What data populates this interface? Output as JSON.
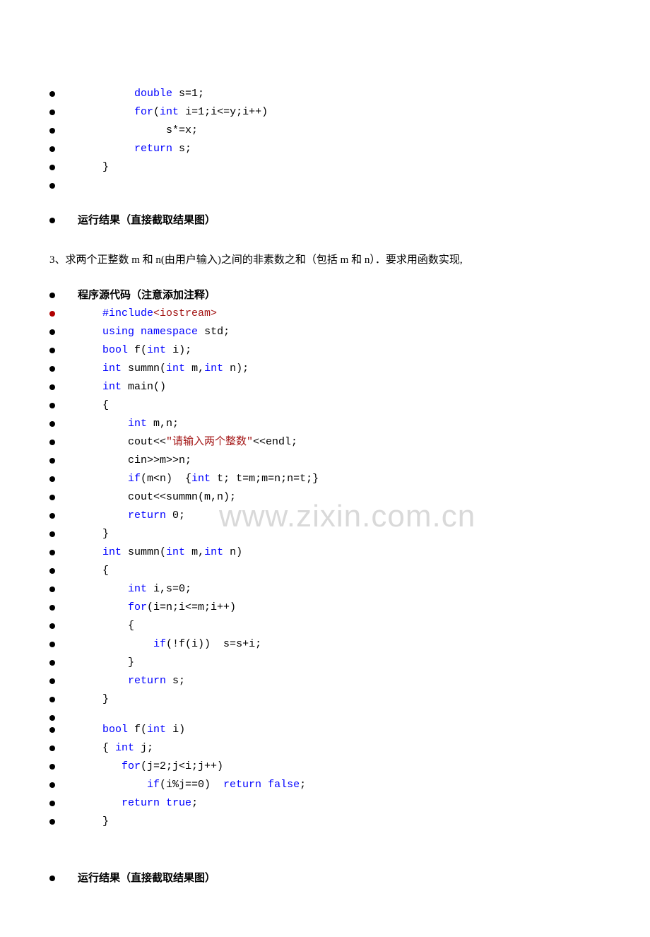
{
  "watermark": "www.zixin.com.cn",
  "block1": {
    "lines": [
      {
        "indent": "        ",
        "parts": [
          {
            "c": "kw",
            "t": "double"
          },
          {
            "c": "txt",
            "t": " s=1;"
          }
        ]
      },
      {
        "indent": "        ",
        "parts": [
          {
            "c": "kw",
            "t": "for"
          },
          {
            "c": "txt",
            "t": "("
          },
          {
            "c": "kw",
            "t": "int"
          },
          {
            "c": "txt",
            "t": " i=1;i<=y;i++)"
          }
        ]
      },
      {
        "indent": "             ",
        "parts": [
          {
            "c": "txt",
            "t": "s*=x;"
          }
        ]
      },
      {
        "indent": "        ",
        "parts": [
          {
            "c": "kw",
            "t": "return"
          },
          {
            "c": "txt",
            "t": " s;"
          }
        ]
      },
      {
        "indent": "   ",
        "parts": [
          {
            "c": "txt",
            "t": "}"
          }
        ]
      },
      {
        "indent": "",
        "parts": []
      }
    ]
  },
  "heading1": "运行结果（直接截取结果图）",
  "paragraph": "3、求两个正整数 m 和 n(由用户输入)之间的非素数之和（包括 m 和 n）．要求用函数实现,",
  "heading2": "程序源代码（注意添加注释）",
  "block2": {
    "lines": [
      {
        "red": true,
        "indent": "   ",
        "parts": [
          {
            "c": "kw",
            "t": "#include"
          },
          {
            "c": "inc",
            "t": "<iostream>"
          }
        ]
      },
      {
        "indent": "   ",
        "parts": [
          {
            "c": "kw",
            "t": "using"
          },
          {
            "c": "txt",
            "t": " "
          },
          {
            "c": "kw",
            "t": "namespace"
          },
          {
            "c": "txt",
            "t": " std;"
          }
        ]
      },
      {
        "indent": "   ",
        "parts": [
          {
            "c": "kw",
            "t": "bool"
          },
          {
            "c": "txt",
            "t": " f("
          },
          {
            "c": "kw",
            "t": "int"
          },
          {
            "c": "txt",
            "t": " i);"
          }
        ]
      },
      {
        "indent": "   ",
        "parts": [
          {
            "c": "kw",
            "t": "int"
          },
          {
            "c": "txt",
            "t": " summn("
          },
          {
            "c": "kw",
            "t": "int"
          },
          {
            "c": "txt",
            "t": " m,"
          },
          {
            "c": "kw",
            "t": "int"
          },
          {
            "c": "txt",
            "t": " n);"
          }
        ]
      },
      {
        "indent": "   ",
        "parts": [
          {
            "c": "kw",
            "t": "int"
          },
          {
            "c": "txt",
            "t": " main()"
          }
        ]
      },
      {
        "indent": "   ",
        "parts": [
          {
            "c": "txt",
            "t": "{"
          }
        ]
      },
      {
        "indent": "       ",
        "parts": [
          {
            "c": "kw",
            "t": "int"
          },
          {
            "c": "txt",
            "t": " m,n;"
          }
        ]
      },
      {
        "indent": "       ",
        "parts": [
          {
            "c": "txt",
            "t": "cout<<"
          },
          {
            "c": "str",
            "t": "\"请输入两个整数\""
          },
          {
            "c": "txt",
            "t": "<<endl;"
          }
        ]
      },
      {
        "indent": "       ",
        "parts": [
          {
            "c": "txt",
            "t": "cin>>m>>n;"
          }
        ]
      },
      {
        "indent": "       ",
        "parts": [
          {
            "c": "kw",
            "t": "if"
          },
          {
            "c": "txt",
            "t": "(m<n)  {"
          },
          {
            "c": "kw",
            "t": "int"
          },
          {
            "c": "txt",
            "t": " t; t=m;m=n;n=t;}"
          }
        ]
      },
      {
        "indent": "       ",
        "parts": [
          {
            "c": "txt",
            "t": "cout<<summn(m,n);"
          }
        ]
      },
      {
        "indent": "       ",
        "parts": [
          {
            "c": "kw",
            "t": "return"
          },
          {
            "c": "txt",
            "t": " 0;"
          }
        ]
      },
      {
        "indent": "   ",
        "parts": [
          {
            "c": "txt",
            "t": "}"
          }
        ]
      },
      {
        "indent": "   ",
        "parts": [
          {
            "c": "kw",
            "t": "int"
          },
          {
            "c": "txt",
            "t": " summn("
          },
          {
            "c": "kw",
            "t": "int"
          },
          {
            "c": "txt",
            "t": " m,"
          },
          {
            "c": "kw",
            "t": "int"
          },
          {
            "c": "txt",
            "t": " n)"
          }
        ]
      },
      {
        "indent": "   ",
        "parts": [
          {
            "c": "txt",
            "t": "{"
          }
        ]
      },
      {
        "indent": "       ",
        "parts": [
          {
            "c": "kw",
            "t": "int"
          },
          {
            "c": "txt",
            "t": " i,s=0;"
          }
        ]
      },
      {
        "indent": "       ",
        "parts": [
          {
            "c": "kw",
            "t": "for"
          },
          {
            "c": "txt",
            "t": "(i=n;i<=m;i++)"
          }
        ]
      },
      {
        "indent": "       ",
        "parts": [
          {
            "c": "txt",
            "t": "{"
          }
        ]
      },
      {
        "indent": "           ",
        "parts": [
          {
            "c": "kw",
            "t": "if"
          },
          {
            "c": "txt",
            "t": "(!f(i))  s=s+i;"
          }
        ]
      },
      {
        "indent": "       ",
        "parts": [
          {
            "c": "txt",
            "t": "}"
          }
        ]
      },
      {
        "indent": "       ",
        "parts": [
          {
            "c": "kw",
            "t": "return"
          },
          {
            "c": "txt",
            "t": " s;"
          }
        ]
      },
      {
        "indent": "   ",
        "parts": [
          {
            "c": "txt",
            "t": "}"
          }
        ]
      },
      {
        "indent": "",
        "parts": []
      },
      {
        "indent": "   ",
        "parts": [
          {
            "c": "kw",
            "t": "bool"
          },
          {
            "c": "txt",
            "t": " f("
          },
          {
            "c": "kw",
            "t": "int"
          },
          {
            "c": "txt",
            "t": " i)"
          }
        ]
      },
      {
        "indent": "   ",
        "parts": [
          {
            "c": "txt",
            "t": "{ "
          },
          {
            "c": "kw",
            "t": "int"
          },
          {
            "c": "txt",
            "t": " j;"
          }
        ]
      },
      {
        "indent": "      ",
        "parts": [
          {
            "c": "kw",
            "t": "for"
          },
          {
            "c": "txt",
            "t": "(j=2;j<i;j++)"
          }
        ]
      },
      {
        "indent": "          ",
        "parts": [
          {
            "c": "kw",
            "t": "if"
          },
          {
            "c": "txt",
            "t": "(i%j==0)  "
          },
          {
            "c": "kw",
            "t": "return"
          },
          {
            "c": "txt",
            "t": " "
          },
          {
            "c": "kw",
            "t": "false"
          },
          {
            "c": "txt",
            "t": ";"
          }
        ]
      },
      {
        "indent": "      ",
        "parts": [
          {
            "c": "kw",
            "t": "return"
          },
          {
            "c": "txt",
            "t": " "
          },
          {
            "c": "kw",
            "t": "true"
          },
          {
            "c": "txt",
            "t": ";"
          }
        ]
      },
      {
        "indent": "   ",
        "parts": [
          {
            "c": "txt",
            "t": "}"
          }
        ]
      }
    ]
  },
  "heading3": "运行结果（直接截取结果图）"
}
